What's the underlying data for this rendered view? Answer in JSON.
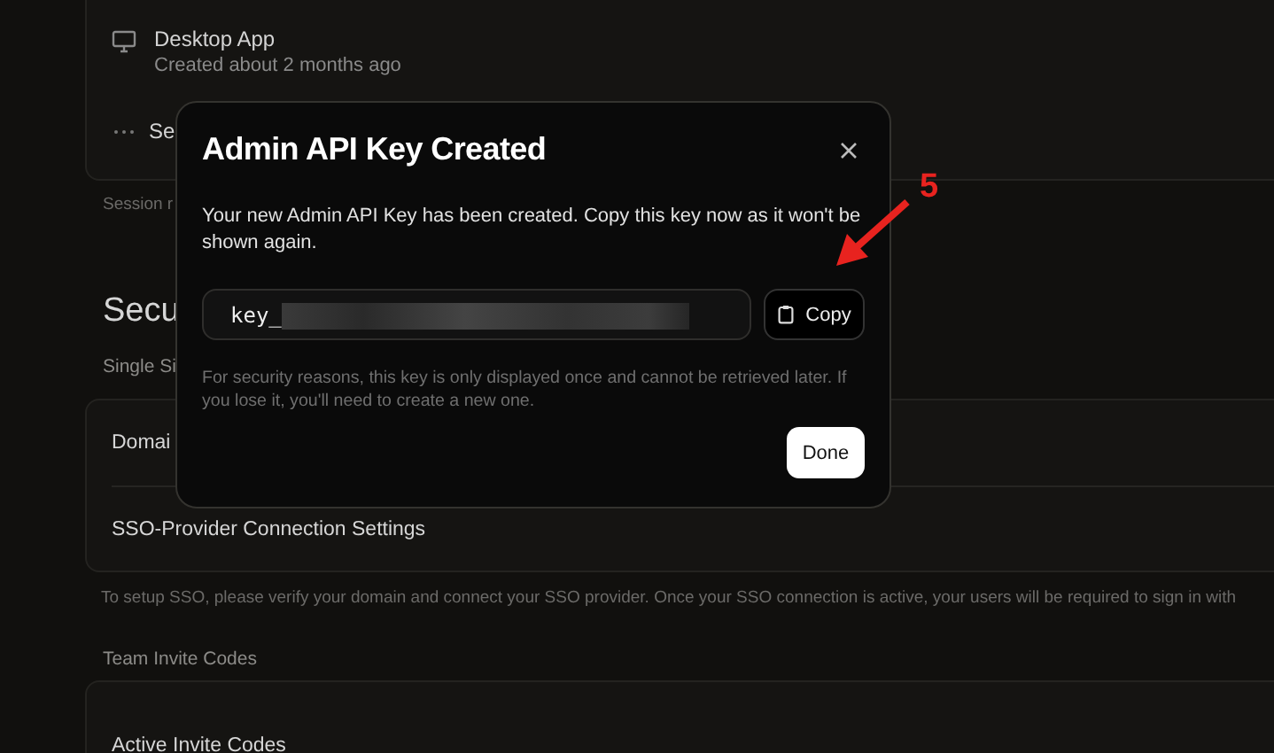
{
  "background": {
    "sessions": [
      {
        "kind": "device",
        "name": "Desktop App",
        "detail": "Created about 2 months ago"
      },
      {
        "kind": "more",
        "name": "Se"
      }
    ],
    "session_note": "Session r",
    "security_heading": "Secu",
    "sso_label": "Single Si",
    "sso_items": [
      "Domai",
      "SSO-Provider Connection Settings"
    ],
    "sso_note": "To setup SSO, please verify your domain and connect your SSO provider. Once your SSO connection is active, your users will be required to sign in with",
    "invite_label": "Team Invite Codes",
    "invite_items": [
      "Active Invite Codes"
    ]
  },
  "dialog": {
    "title": "Admin API Key Created",
    "message": "Your new Admin API Key has been created. Copy this key now as it won't be shown again.",
    "key_prefix": "key_",
    "copy_button": "Copy",
    "warning": "For security reasons, this key is only displayed once and cannot be retrieved later. If you lose it, you'll need to create a new one.",
    "done_button": "Done"
  },
  "annotation": {
    "label": "5"
  }
}
